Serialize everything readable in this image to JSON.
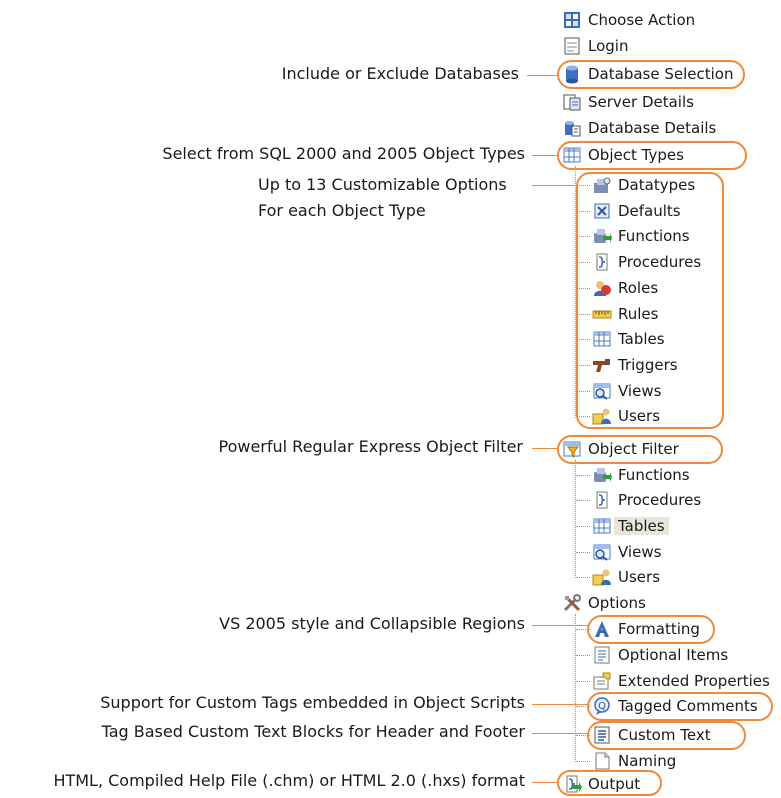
{
  "tree": {
    "items": [
      {
        "label": "Choose Action",
        "icon": "choose-action-icon"
      },
      {
        "label": "Login",
        "icon": "login-icon"
      },
      {
        "label": "Database Selection",
        "icon": "database-icon"
      },
      {
        "label": "Server Details",
        "icon": "server-details-icon"
      },
      {
        "label": "Database Details",
        "icon": "database-details-icon"
      },
      {
        "label": "Object Types",
        "icon": "object-types-icon"
      },
      {
        "label": "Datatypes",
        "icon": "datatypes-icon"
      },
      {
        "label": "Defaults",
        "icon": "defaults-icon"
      },
      {
        "label": "Functions",
        "icon": "functions-icon"
      },
      {
        "label": "Procedures",
        "icon": "procedures-icon"
      },
      {
        "label": "Roles",
        "icon": "roles-icon"
      },
      {
        "label": "Rules",
        "icon": "rules-icon"
      },
      {
        "label": "Tables",
        "icon": "tables-icon"
      },
      {
        "label": "Triggers",
        "icon": "triggers-icon"
      },
      {
        "label": "Views",
        "icon": "views-icon"
      },
      {
        "label": "Users",
        "icon": "users-icon"
      },
      {
        "label": "Object Filter",
        "icon": "object-filter-icon"
      },
      {
        "label": "Functions",
        "icon": "functions-icon"
      },
      {
        "label": "Procedures",
        "icon": "procedures-icon"
      },
      {
        "label": "Tables",
        "icon": "tables-icon"
      },
      {
        "label": "Views",
        "icon": "views-icon"
      },
      {
        "label": "Users",
        "icon": "users-icon"
      },
      {
        "label": "Options",
        "icon": "options-icon"
      },
      {
        "label": "Formatting",
        "icon": "formatting-icon"
      },
      {
        "label": "Optional Items",
        "icon": "optional-items-icon"
      },
      {
        "label": "Extended Properties",
        "icon": "extended-properties-icon"
      },
      {
        "label": "Tagged Comments",
        "icon": "tagged-comments-icon"
      },
      {
        "label": "Custom Text",
        "icon": "custom-text-icon"
      },
      {
        "label": "Naming",
        "icon": "naming-icon"
      },
      {
        "label": "Output",
        "icon": "output-icon"
      }
    ]
  },
  "annotations": {
    "database_selection": "Include or Exclude Databases",
    "object_types": "Select from SQL 2000 and 2005 Object Types",
    "options_line1": "Up to 13 Customizable Options",
    "options_line2": "For each Object Type",
    "object_filter": "Powerful Regular Express Object Filter",
    "formatting": "VS 2005 style and Collapsible Regions",
    "tagged_comments": "Support for Custom Tags embedded in Object Scripts",
    "custom_text": "Tag Based Custom Text Blocks for Header and Footer",
    "output": "HTML, Compiled Help File (.chm) or HTML 2.0 (.hxs) format"
  },
  "colors": {
    "highlight": "#f08a3a",
    "selected_bg": "#e8e6dc"
  }
}
